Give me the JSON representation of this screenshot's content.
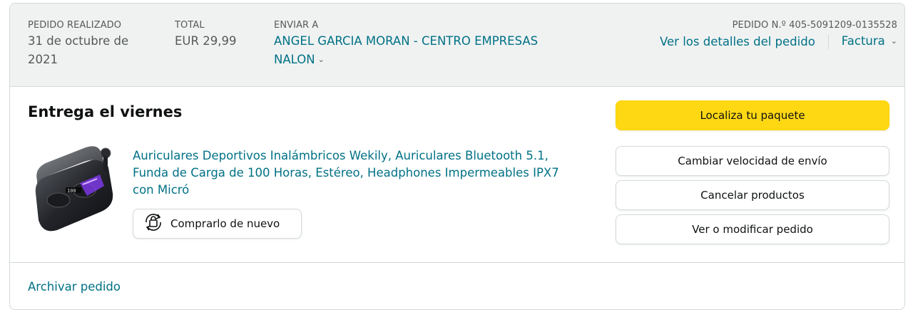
{
  "header": {
    "date_label": "PEDIDO REALIZADO",
    "date_line1": "31 de octubre de",
    "date_line2": "2021",
    "total_label": "TOTAL",
    "total_value": "EUR 29,99",
    "ship_label": "ENVIAR A",
    "ship_line1": "ANGEL GARCIA MORAN - CENTRO EMPRESAS",
    "ship_line2": "NALON",
    "order_label": "PEDIDO N.º 405-5091209-0135528",
    "details_link": "Ver los detalles del pedido",
    "invoice_link": "Factura"
  },
  "delivery": {
    "title": "Entrega el viernes"
  },
  "product": {
    "title_line1": "Auriculares Deportivos Inalámbricos Wekily, Auriculares Bluetooth 5.1,",
    "title_line2": "Funda de Carga de 100 Horas, Estéreo, Headphones Impermeables IPX7",
    "title_line3": "con Micró",
    "buy_again_label": "Comprarlo de nuevo"
  },
  "actions": {
    "track": "Localiza tu paquete",
    "change_speed": "Cambiar velocidad de envío",
    "cancel": "Cancelar productos",
    "view_modify": "Ver o modificar pedido"
  },
  "footer": {
    "archive": "Archivar pedido"
  },
  "colors": {
    "link": "#007185",
    "primary_button": "#ffd814",
    "header_bg": "#f0f2f2",
    "border": "#d5d9d9"
  },
  "icons": {
    "buy_again": "buy-again-icon",
    "chevron": "chevron-down-icon"
  }
}
